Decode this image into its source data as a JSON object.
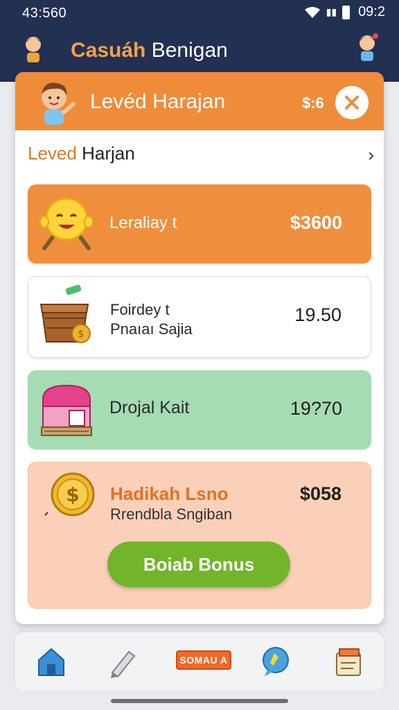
{
  "status_bar": {
    "time": "43:560",
    "clock": "09:2"
  },
  "app_bar": {
    "title_part1": "Casuáh",
    "title_part2": "Benigan"
  },
  "sheet": {
    "header_title": "Levéd Harajan",
    "header_price": "$:6",
    "subhead_part1": "Leved",
    "subhead_part2": "Harjan",
    "accent_color": "#ee8c3a"
  },
  "offers": [
    {
      "label": "Leraliay t",
      "value": "$3600"
    },
    {
      "label_line1": "Foirdey t",
      "label_line2": "Pnaıaı Sajia",
      "value": "19.50"
    },
    {
      "label": "Drojal Kait",
      "value": "19?70"
    },
    {
      "label": "Hadikah Lsno",
      "sublabel": "Rrendbla Sngiban",
      "value": "$058",
      "button": "Boiab Bonus"
    }
  ],
  "bottom_nav": {
    "bonus_tag": "SOMAU A"
  },
  "icons": [
    "home-icon",
    "pencil-icon",
    "bonus-tag-icon",
    "chat-bubble-icon",
    "notes-icon",
    "close-icon",
    "chevron-right-icon"
  ]
}
